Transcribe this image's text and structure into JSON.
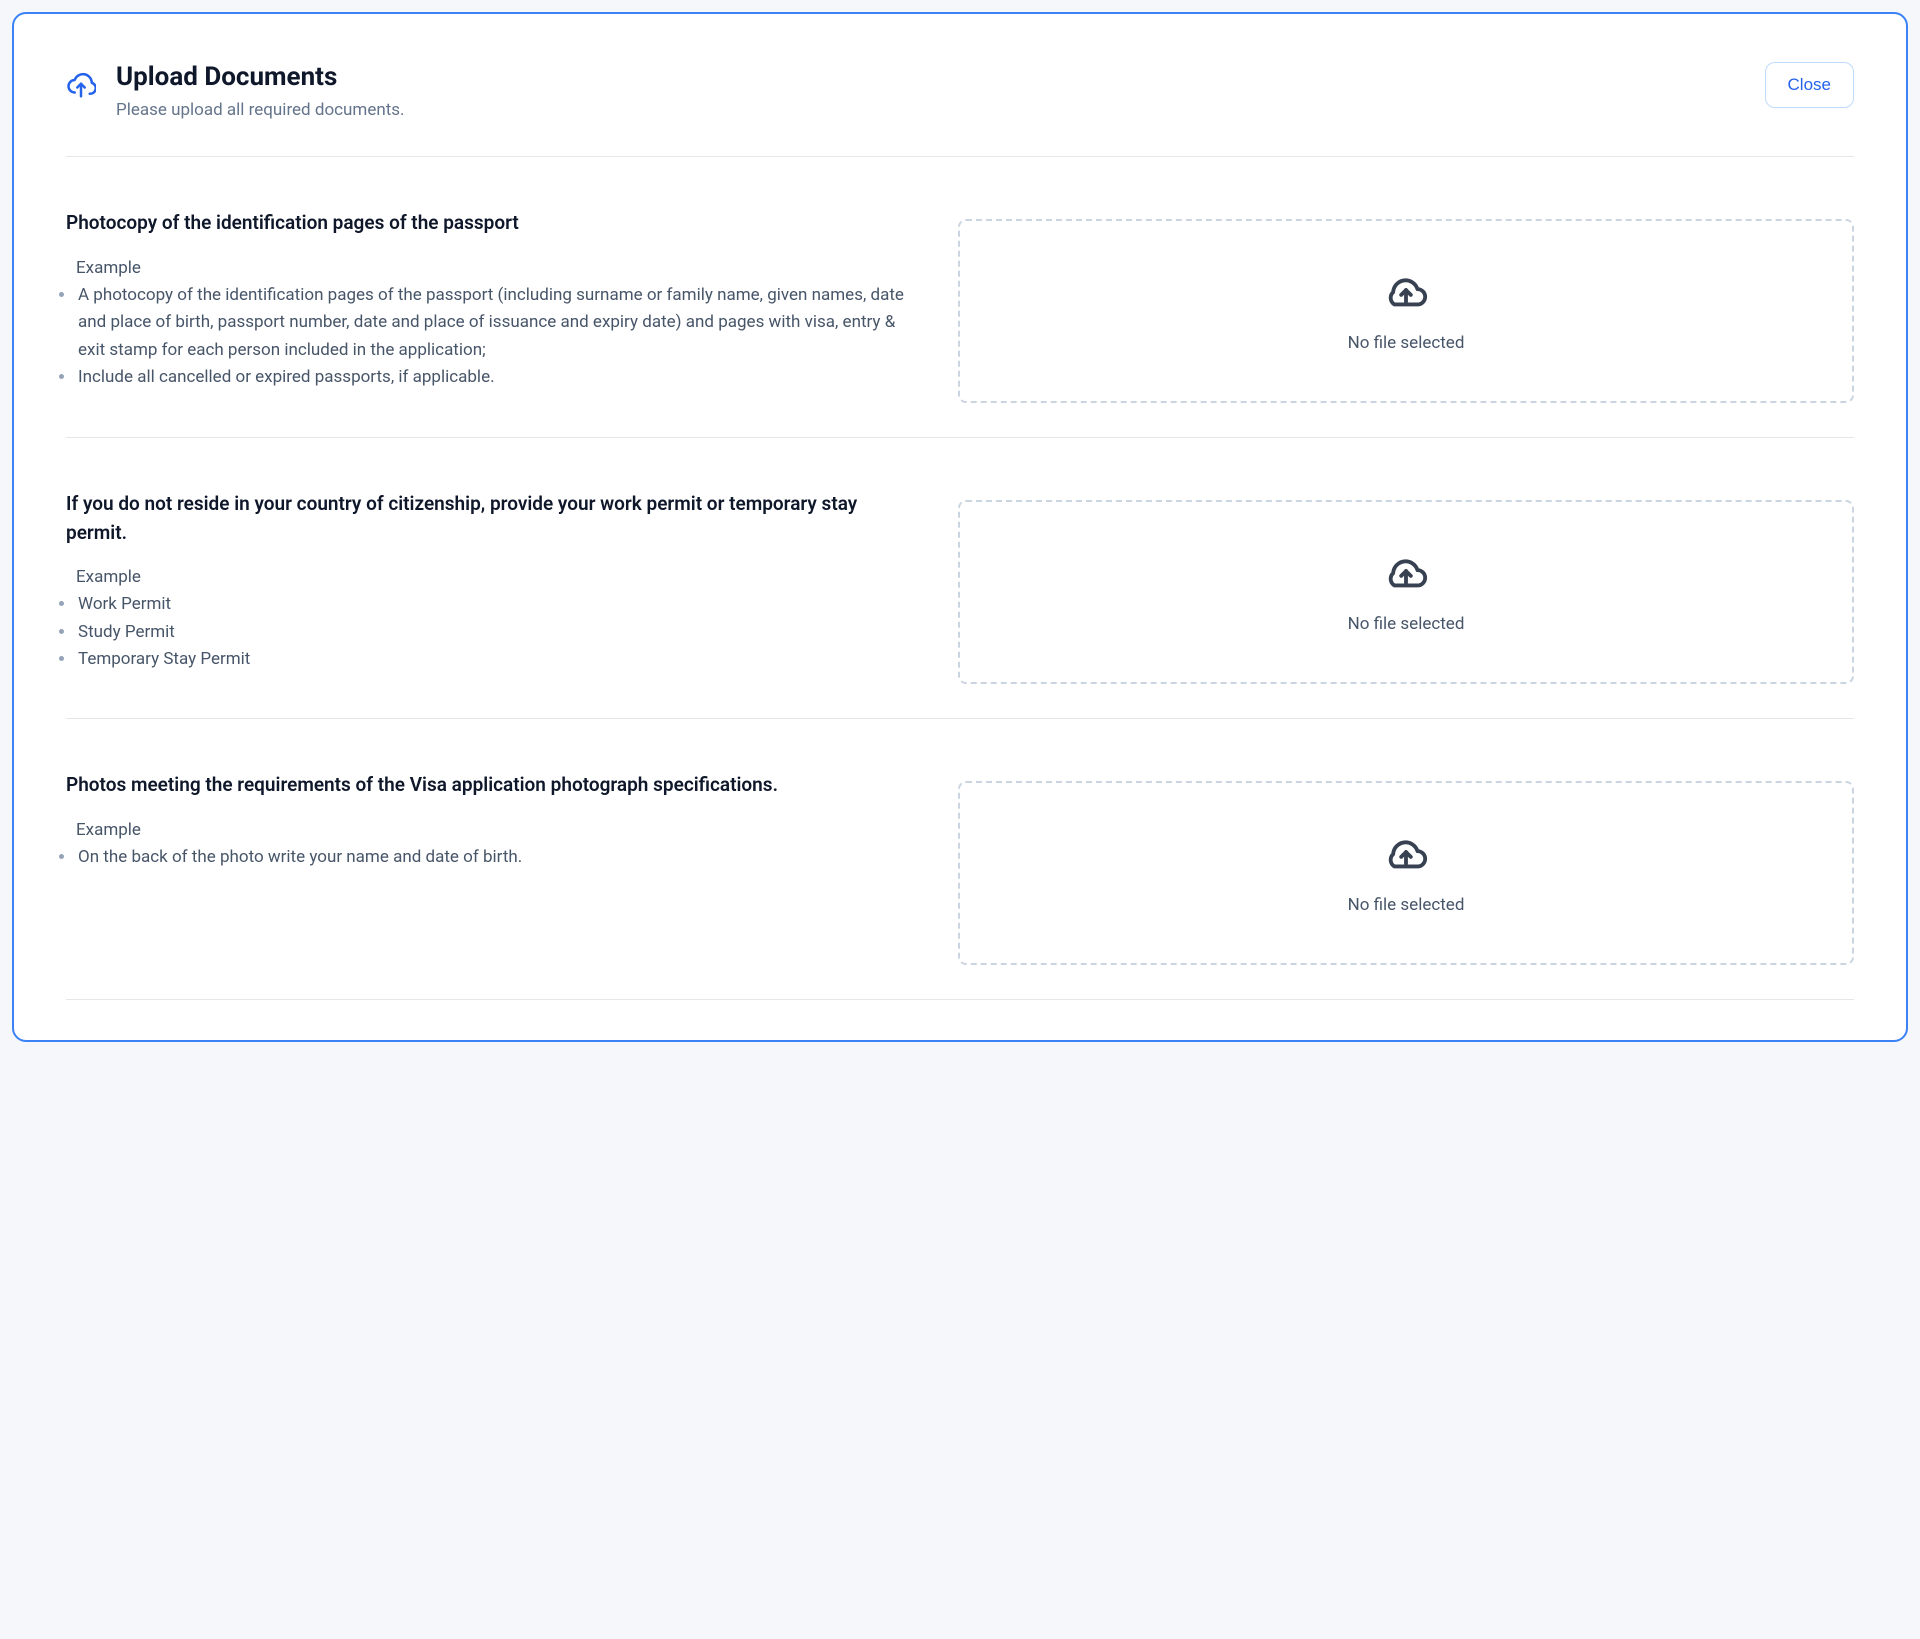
{
  "modal": {
    "title": "Upload Documents",
    "subtitle": "Please upload all required documents.",
    "close_label": "Close"
  },
  "dropzone": {
    "placeholder_text": "No file selected"
  },
  "documents": [
    {
      "title": "Photocopy of the identification pages of the passport",
      "example_label": "Example",
      "items": [
        "A photocopy of the identification pages of the passport (including surname or family name, given names, date and place of birth, passport number, date and place of issuance and expiry date) and pages with visa, entry & exit stamp for each person included in the application;",
        "Include all cancelled or expired passports, if applicable."
      ]
    },
    {
      "title": "If you do not reside in your country of citizenship, provide your work permit or temporary stay permit.",
      "example_label": "Example",
      "items": [
        "Work Permit",
        "Study Permit",
        "Temporary Stay Permit"
      ]
    },
    {
      "title": "Photos meeting the requirements of the Visa application photograph specifications.",
      "example_label": "Example",
      "items": [
        "On the back of the photo write your name and date of birth."
      ]
    }
  ]
}
